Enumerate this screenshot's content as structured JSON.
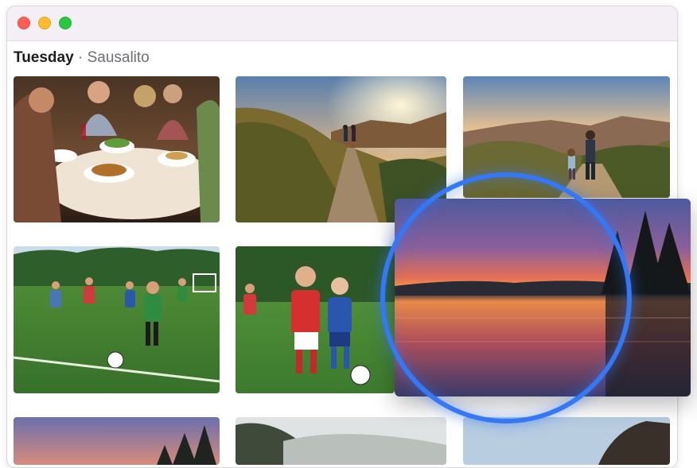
{
  "window": {
    "controls": {
      "close": "close-button",
      "minimize": "minimize-button",
      "zoom": "zoom-button"
    }
  },
  "section": {
    "day": "Tuesday",
    "separator": " · ",
    "place": "Sausalito"
  },
  "photos": [
    {
      "subject": "family dinner"
    },
    {
      "subject": "hikers on sunset trail"
    },
    {
      "subject": "hiking mother and child"
    },
    {
      "subject": "kids soccer game"
    },
    {
      "subject": "kids soccer close-up"
    },
    {
      "subject": "sunset over trees"
    },
    {
      "subject": "misty hills"
    },
    {
      "subject": "rock silhouette"
    }
  ],
  "highlight": {
    "subject": "sunset over lake",
    "ring_color": "#3478f6"
  },
  "colors": {
    "accent": "#3478f6",
    "titlebar": "#f3eff5",
    "text": "#1d1d1f",
    "secondary_text": "#6e6e73"
  }
}
